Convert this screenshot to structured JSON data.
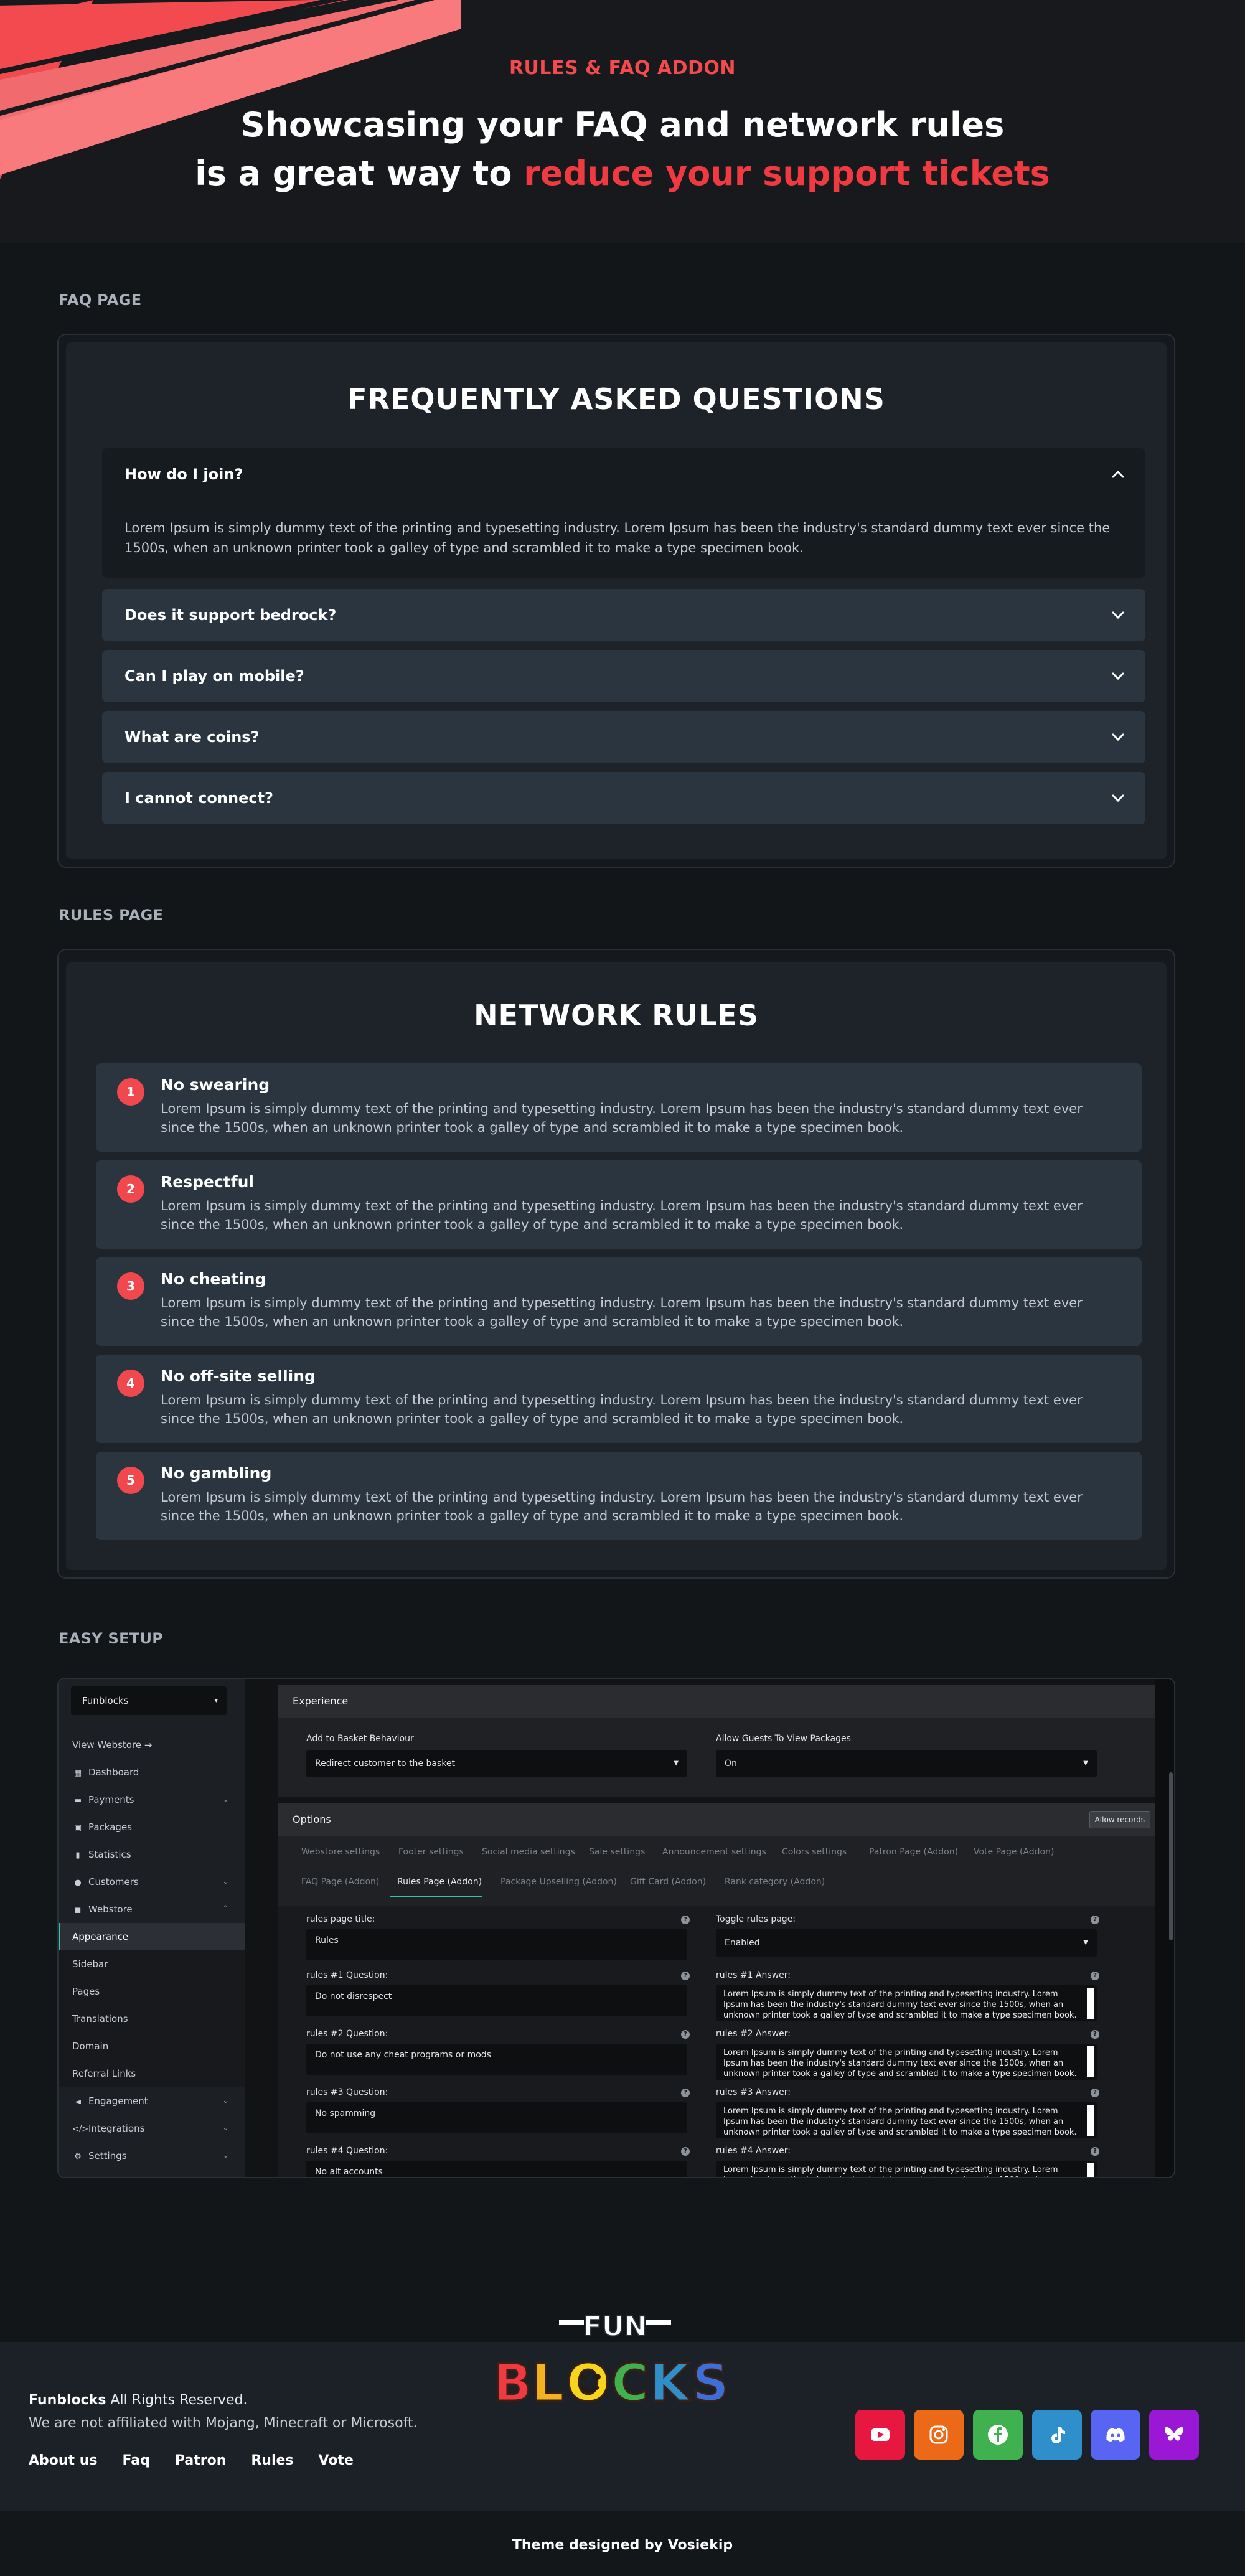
{
  "hero": {
    "eyebrow": "RULES & FAQ ADDON",
    "title_line1": "Showcasing your FAQ and network rules",
    "title_line2_prefix": "is a great way to ",
    "title_line2_accent": "reduce your support tickets"
  },
  "sections": {
    "faq_label": "FAQ PAGE",
    "rules_label": "RULES PAGE",
    "setup_label": "EASY SETUP"
  },
  "faq": {
    "title": "FREQUENTLY ASKED QUESTIONS",
    "items": [
      {
        "question": "How do I join?",
        "answer": "Lorem Ipsum is simply dummy text of the printing and typesetting industry. Lorem Ipsum has been the industry's standard dummy text ever since the 1500s, when an unknown printer took a galley of type and scrambled it to make a type specimen book.",
        "open": true
      },
      {
        "question": "Does it support bedrock?",
        "open": false
      },
      {
        "question": "Can I play on mobile?",
        "open": false
      },
      {
        "question": "What are coins?",
        "open": false
      },
      {
        "question": "I cannot connect?",
        "open": false
      }
    ]
  },
  "rules": {
    "title": "NETWORK RULES",
    "items": [
      {
        "number": "1",
        "title": "No swearing",
        "text": "Lorem Ipsum is simply dummy text of the printing and typesetting industry. Lorem Ipsum has been the industry's standard dummy text ever since the 1500s, when an unknown printer took a galley of type and scrambled it to make a type specimen book."
      },
      {
        "number": "2",
        "title": "Respectful",
        "text": "Lorem Ipsum is simply dummy text of the printing and typesetting industry. Lorem Ipsum has been the industry's standard dummy text ever since the 1500s, when an unknown printer took a galley of type and scrambled it to make a type specimen book."
      },
      {
        "number": "3",
        "title": "No cheating",
        "text": "Lorem Ipsum is simply dummy text of the printing and typesetting industry. Lorem Ipsum has been the industry's standard dummy text ever since the 1500s, when an unknown printer took a galley of type and scrambled it to make a type specimen book."
      },
      {
        "number": "4",
        "title": "No off-site selling",
        "text": "Lorem Ipsum is simply dummy text of the printing and typesetting industry. Lorem Ipsum has been the industry's standard dummy text ever since the 1500s, when an unknown printer took a galley of type and scrambled it to make a type specimen book."
      },
      {
        "number": "5",
        "title": "No gambling",
        "text": "Lorem Ipsum is simply dummy text of the printing and typesetting industry. Lorem Ipsum has been the industry's standard dummy text ever since the 1500s, when an unknown printer took a galley of type and scrambled it to make a type specimen book."
      }
    ]
  },
  "admin": {
    "store_select": "Funblocks",
    "sidebar": {
      "view_webstore": "View Webstore",
      "dashboard": "Dashboard",
      "payments": "Payments",
      "packages": "Packages",
      "statistics": "Statistics",
      "customers": "Customers",
      "webstore": "Webstore",
      "appearance": "Appearance",
      "sidebar": "Sidebar",
      "pages": "Pages",
      "translations": "Translations",
      "domain": "Domain",
      "referral_links": "Referral Links",
      "engagement": "Engagement",
      "integrations": "Integrations",
      "settings": "Settings"
    },
    "experience": {
      "header": "Experience",
      "basket_label": "Add to Basket Behaviour",
      "basket_value": "Redirect customer to the basket",
      "guests_label": "Allow Guests To View Packages",
      "guests_value": "On"
    },
    "options": {
      "header": "Options",
      "allow_button": "Allow records",
      "tabs_row1": [
        "Webstore settings",
        "Footer settings",
        "Social media settings",
        "Sale settings",
        "Announcement settings",
        "Colors settings",
        "Patron Page (Addon)",
        "Vote Page (Addon)"
      ],
      "tabs_row2": [
        "FAQ Page (Addon)",
        "Rules Page (Addon)",
        "Package Upselling (Addon)",
        "Gift Card (Addon)",
        "Rank category (Addon)"
      ],
      "active_tab": "Rules Page (Addon)",
      "title_label": "rules page title:",
      "title_value": "Rules",
      "toggle_label": "Toggle rules page:",
      "toggle_value": "Enabled",
      "questions": [
        {
          "q_label": "rules #1 Question:",
          "q_value": "Do not disrespect",
          "a_label": "rules #1 Answer:"
        },
        {
          "q_label": "rules #2 Question:",
          "q_value": "Do not use any cheat programs or mods",
          "a_label": "rules #2 Answer:"
        },
        {
          "q_label": "rules #3 Question:",
          "q_value": "No spamming",
          "a_label": "rules #3 Answer:"
        },
        {
          "q_label": "rules #4 Question:",
          "q_value": "No alt accounts",
          "a_label": "rules #4 Answer:"
        }
      ],
      "answer_text": "Lorem Ipsum is simply dummy text of the printing and typesetting industry. Lorem Ipsum has been the industry's standard dummy text ever since the 1500s, when an unknown printer took a galley of type and scrambled it to make a type specimen book."
    }
  },
  "footer": {
    "brand": "Funblocks",
    "rights": " All Rights Reserved.",
    "disclaimer": "We are not affiliated with Mojang, Minecraft or Microsoft.",
    "links": [
      "About us",
      "Faq",
      "Patron",
      "Rules",
      "Vote"
    ],
    "logo_top": "FUN",
    "logo_bottom": "BLOCKS",
    "credit": "Theme designed by Vosiekip",
    "socials": [
      {
        "name": "youtube-icon",
        "color": "#e8173f"
      },
      {
        "name": "instagram-icon",
        "color": "#ec6a17"
      },
      {
        "name": "facebook-icon",
        "color": "#3fb14f"
      },
      {
        "name": "tiktok-icon",
        "color": "#2e8fcb"
      },
      {
        "name": "discord-icon",
        "color": "#5865f2"
      },
      {
        "name": "bluesky-icon",
        "color": "#9b17d6"
      }
    ]
  },
  "colors": {
    "accent": "#ef3a42",
    "teal": "#2ec4b6",
    "bg": "#131619",
    "card": "#2a3540"
  }
}
